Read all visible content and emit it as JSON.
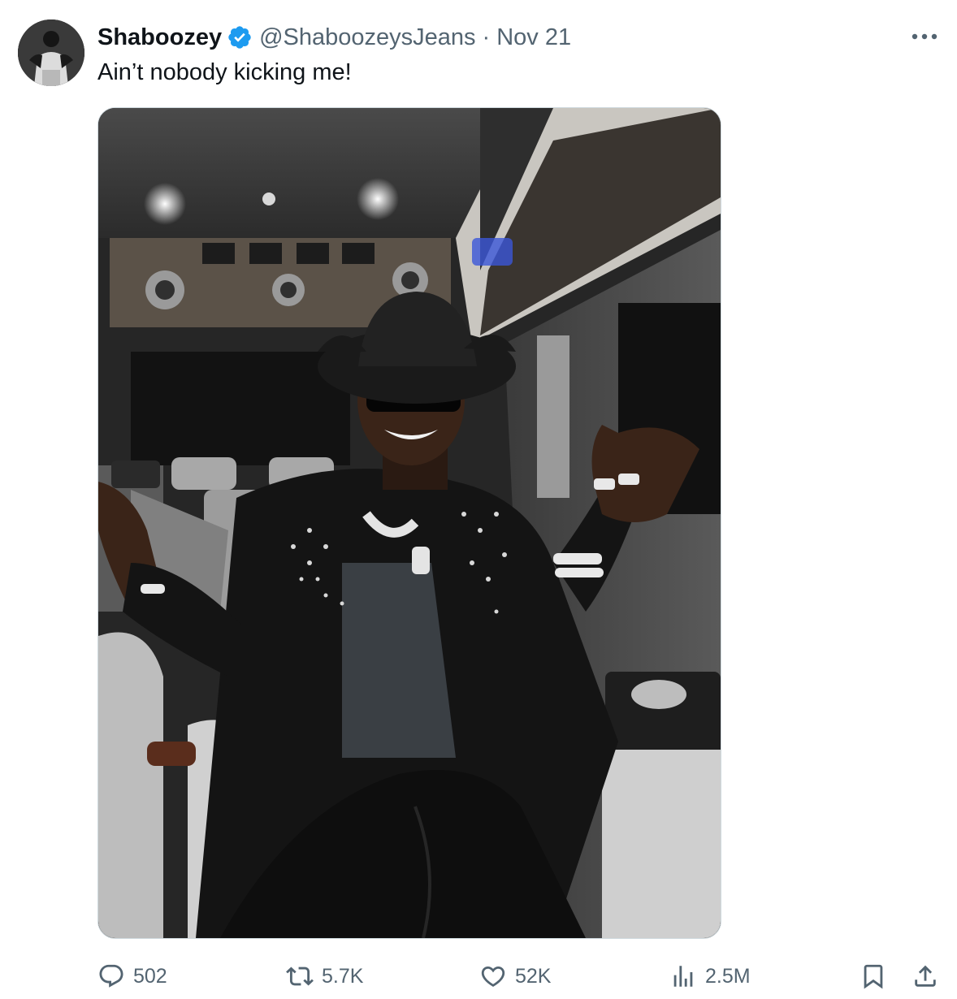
{
  "tweet": {
    "author_name": "Shaboozey",
    "verified_icon": "verified-badge-icon",
    "handle": "@ShaboozeysJeans",
    "separator": "·",
    "date": "Nov 21",
    "text": "Ain’t nobody kicking me!",
    "more_icon": "more-dots-icon"
  },
  "actions": {
    "replies": "502",
    "reposts": "5.7K",
    "likes": "52K",
    "views": "2.5M",
    "icons": [
      "reply-icon",
      "repost-icon",
      "like-icon",
      "views-icon",
      "bookmark-icon",
      "share-icon"
    ]
  },
  "colors": {
    "text_primary": "#0f1419",
    "text_secondary": "#536471",
    "verified_blue": "#1d9bf0",
    "border": "#cfd9de"
  }
}
